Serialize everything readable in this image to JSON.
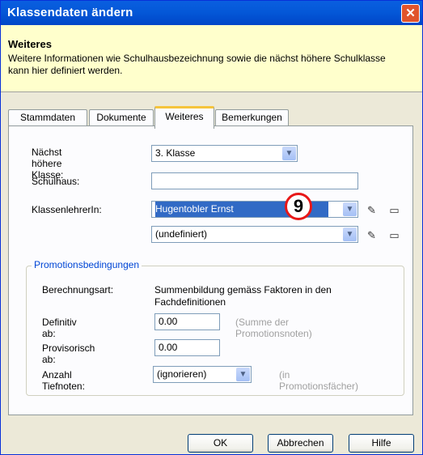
{
  "window": {
    "title": "Klassendaten ändern",
    "close_glyph": "✕"
  },
  "header": {
    "title": "Weiteres",
    "description": "Weitere Informationen wie Schulhausbezeichnung sowie die nächst höhere Schulklasse kann hier definiert werden."
  },
  "tabs": [
    {
      "label": "Stammdaten",
      "active": false
    },
    {
      "label": "Dokumente",
      "active": false
    },
    {
      "label": "Weiteres",
      "active": true
    },
    {
      "label": "Bemerkungen",
      "active": false
    }
  ],
  "form": {
    "naechst_label": "Nächst höhere Klasse:",
    "naechst_value": "3. Klasse",
    "schulhaus_label": "Schulhaus:",
    "schulhaus_value": "",
    "lehrer_label": "KlassenlehrerIn:",
    "lehrer1_value": "Hugentobler Ernst",
    "lehrer2_value": "(undefiniert)"
  },
  "promotion": {
    "title": "Promotionsbedingungen",
    "berechnung_label": "Berechnungsart:",
    "berechnung_value": "Summenbildung gemäss Faktoren in den Fachdefinitionen",
    "definitiv_label": "Definitiv ab:",
    "definitiv_value": "0.00",
    "definitiv_hint": "(Summe der Promotionsnoten)",
    "provisorisch_label": "Provisorisch ab:",
    "provisorisch_value": "0.00",
    "tiefnoten_label": "Anzahl Tiefnoten:",
    "tiefnoten_value": "(ignorieren)",
    "tiefnoten_hint": "(in Promotionsfächer)"
  },
  "buttons": {
    "ok": "OK",
    "cancel": "Abbrechen",
    "help": "Hilfe"
  },
  "annotation": {
    "number": "9"
  },
  "icons": {
    "dropdown": "chevron-down-icon",
    "edit": "edit-icon",
    "folder": "folder-icon"
  }
}
